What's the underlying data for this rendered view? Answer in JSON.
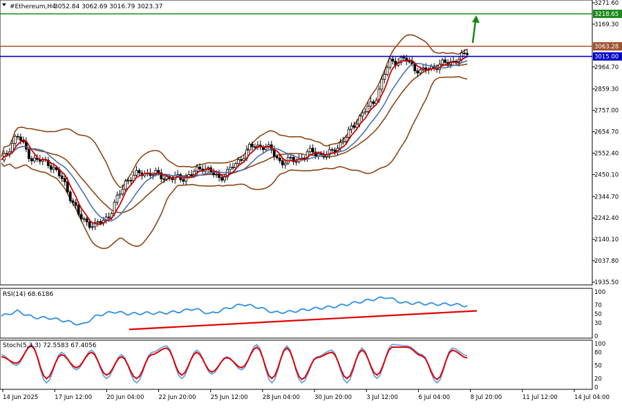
{
  "header": {
    "symbol": "#Ethereum,H4",
    "ohlc": "3052.84 3062.69 3016.79 3023.37",
    "rsi_label": "RSI(14) 68.6186",
    "stoch_label": "Stoch(5,3,3) 72.5583 67.4056"
  },
  "colors": {
    "background": "#ffffff",
    "grid": "#d0d0d0",
    "candle": "#000000",
    "bb": "#8b4513",
    "ma_fast": "#cc0000",
    "ma_slow": "#4a6fb5",
    "rsi": "#2f8ee5",
    "stoch_main": "#6ea0e0",
    "stoch_signal": "#dd0000",
    "trendline": "#e00000",
    "level_green": "#1a8a1a",
    "level_brown": "#a0522d",
    "level_blue": "#0000cc",
    "arrow": "#138a13"
  },
  "chart_data": [
    {
      "type": "candlestick",
      "title": "#Ethereum,H4",
      "x_tick_labels": [
        "14 Jun 2025",
        "17 Jun 12:00",
        "20 Jun 04:00",
        "22 Jun 20:00",
        "25 Jun 12:00",
        "28 Jun 04:00",
        "30 Jun 20:00",
        "3 Jul 12:00",
        "6 Jul 04:00",
        "8 Jul 20:00",
        "11 Jul 12:00",
        "14 Jul 04:00"
      ],
      "y_tick_labels": [
        "3271.60",
        "3169.30",
        "2964.70",
        "2859.30",
        "2757.00",
        "2654.70",
        "2552.40",
        "2450.10",
        "2344.70",
        "2242.40",
        "2140.10",
        "2037.80",
        "1935.50"
      ],
      "ylim": [
        1935.5,
        3271.6
      ],
      "horizontal_levels": [
        {
          "label": "3218.65",
          "value": 3218.65,
          "color": "green"
        },
        {
          "label": "3063.28",
          "value": 3063.28,
          "color": "brown"
        },
        {
          "label": "3015.00",
          "value": 3015.0,
          "color": "blue"
        }
      ],
      "close_path": [
        [
          "14 Jun 2025",
          2510
        ],
        [
          "16 Jun",
          2640
        ],
        [
          "17 Jun 12:00",
          2520
        ],
        [
          "19 Jun",
          2510
        ],
        [
          "20 Jun 04:00",
          2420
        ],
        [
          "21 Jun",
          2250
        ],
        [
          "22 Jun",
          2200
        ],
        [
          "22 Jun 20:00",
          2260
        ],
        [
          "23 Jun",
          2420
        ],
        [
          "24 Jun",
          2460
        ],
        [
          "25 Jun 12:00",
          2450
        ],
        [
          "27 Jun",
          2430
        ],
        [
          "28 Jun 04:00",
          2440
        ],
        [
          "30 Jun",
          2490
        ],
        [
          "30 Jun 20:00",
          2430
        ],
        [
          "1 Jul",
          2490
        ],
        [
          "2 Jul",
          2580
        ],
        [
          "3 Jul 12:00",
          2590
        ],
        [
          "4 Jul",
          2510
        ],
        [
          "5 Jul",
          2520
        ],
        [
          "6 Jul 04:00",
          2560
        ],
        [
          "7 Jul",
          2540
        ],
        [
          "8 Jul",
          2610
        ],
        [
          "8 Jul 20:00",
          2720
        ],
        [
          "9 Jul",
          2800
        ],
        [
          "10 Jul",
          2990
        ],
        [
          "11 Jul",
          3000
        ],
        [
          "11 Jul 12:00",
          2940
        ],
        [
          "12 Jul",
          2970
        ],
        [
          "13 Jul",
          2990
        ],
        [
          "14 Jul 04:00",
          3023.37
        ]
      ],
      "annotation": "arrow pointing up toward 3218.65"
    },
    {
      "type": "line",
      "title": "RSI(14) 68.6186",
      "ylim": [
        0,
        100
      ],
      "y_tick_labels": [
        "100",
        "70",
        "50",
        "30",
        "0"
      ],
      "series": [
        {
          "name": "RSI(14)",
          "values": [
            45,
            56,
            42,
            41,
            34,
            25,
            47,
            55,
            50,
            52,
            52,
            55,
            62,
            50,
            62,
            72,
            65,
            53,
            55,
            60,
            64,
            68,
            75,
            82,
            88,
            75,
            74,
            72,
            72,
            68.6186
          ]
        }
      ],
      "trendline": [
        [
          0,
          15
        ],
        [
          29,
          57
        ]
      ]
    },
    {
      "type": "line",
      "title": "Stoch(5,3,3) 72.5583 67.4056",
      "ylim": [
        0,
        100
      ],
      "y_tick_labels": [
        "100",
        "80",
        "50",
        "20",
        "0"
      ],
      "series": [
        {
          "name": "main",
          "values": [
            75,
            50,
            98,
            10,
            80,
            40,
            85,
            20,
            75,
            10,
            80,
            95,
            20,
            85,
            30,
            70,
            40,
            98,
            10,
            95,
            10,
            70,
            85,
            10,
            90,
            20,
            98,
            95,
            75,
            10,
            90,
            72.5583
          ]
        },
        {
          "name": "signal",
          "values": [
            70,
            55,
            95,
            20,
            75,
            45,
            80,
            28,
            70,
            20,
            75,
            90,
            28,
            80,
            35,
            68,
            45,
            92,
            20,
            90,
            18,
            68,
            80,
            20,
            85,
            28,
            92,
            92,
            72,
            18,
            85,
            67.4056
          ]
        }
      ]
    }
  ]
}
